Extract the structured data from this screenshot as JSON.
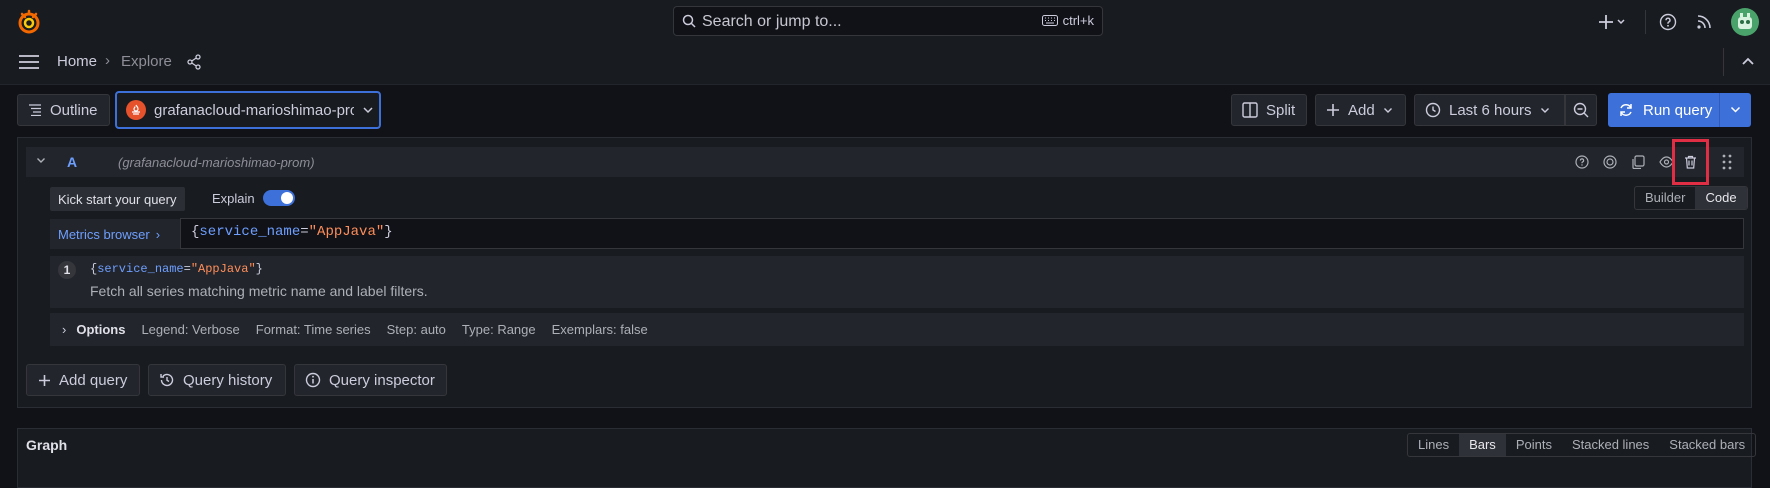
{
  "topbar": {
    "search_placeholder": "Search or jump to...",
    "search_shortcut": "ctrl+k"
  },
  "breadcrumb": {
    "home": "Home",
    "current": "Explore"
  },
  "toolbar": {
    "outline_label": "Outline",
    "datasource": "grafanacloud-marioshimao-pro",
    "split_label": "Split",
    "add_label": "Add",
    "time_range": "Last 6 hours",
    "run_query_label": "Run query"
  },
  "query": {
    "ref_id": "A",
    "datasource_note": "(grafanacloud-marioshimao-prom)",
    "kick_start_label": "Kick start your query",
    "explain_label": "Explain",
    "explain_on": true,
    "mode_builder": "Builder",
    "mode_code": "Code",
    "metrics_browser_label": "Metrics browser",
    "expr_open": "{",
    "expr_label": "service_name",
    "expr_eq": "=",
    "expr_value": "\"AppJava\"",
    "expr_close": "}",
    "explain_step_num": "1",
    "explain_text": "Fetch all series matching metric name and label filters.",
    "options_label": "Options",
    "options_summary": {
      "legend": "Legend: Verbose",
      "format": "Format: Time series",
      "step": "Step: auto",
      "type": "Type: Range",
      "exemplars": "Exemplars: false"
    }
  },
  "actions": {
    "add_query": "Add query",
    "query_history": "Query history",
    "query_inspector": "Query inspector"
  },
  "graph": {
    "title": "Graph",
    "styles": [
      "Lines",
      "Bars",
      "Points",
      "Stacked lines",
      "Stacked bars"
    ],
    "selected_style": "Bars"
  },
  "colors": {
    "primary": "#3d71d9",
    "highlight": "#e02f44",
    "label_key": "#6e9fff",
    "string_value": "#ff8e5a"
  }
}
